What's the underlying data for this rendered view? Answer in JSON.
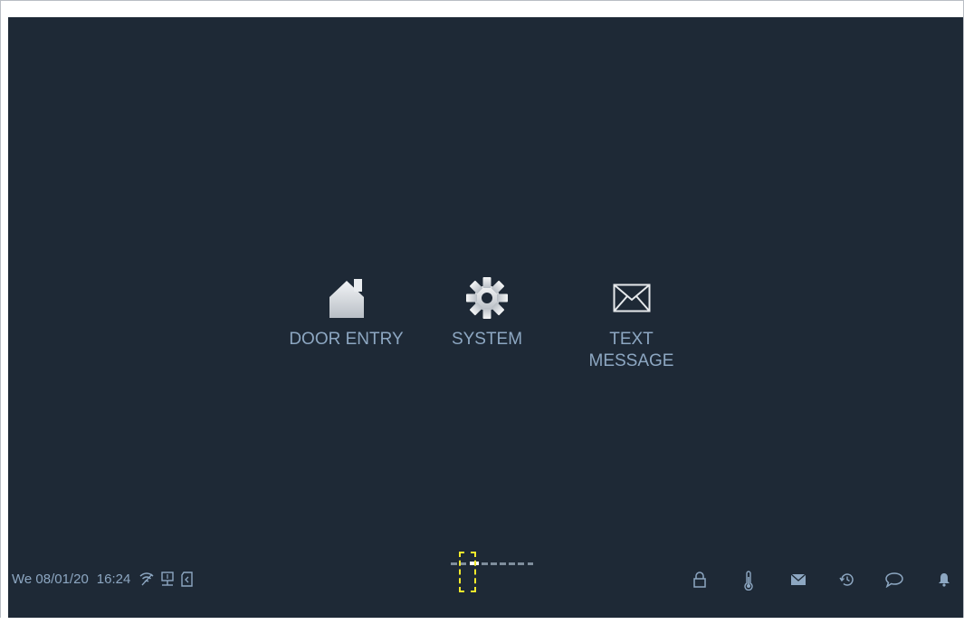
{
  "menu": {
    "items": [
      {
        "label": "DOOR ENTRY",
        "icon": "house-icon"
      },
      {
        "label": "SYSTEM",
        "icon": "gear-icon"
      },
      {
        "label": "TEXT\nMESSAGE",
        "icon": "envelope-icon"
      }
    ]
  },
  "status_bar": {
    "date": "We 08/01/20",
    "time": "16:24",
    "left_icons": [
      "wifi-icon",
      "network-icon",
      "sd-card-icon"
    ],
    "right_icons": [
      "lock-icon",
      "thermometer-icon",
      "mail-icon",
      "history-icon",
      "chat-icon",
      "bell-icon"
    ]
  },
  "pager": {
    "page_count": 8,
    "current_page": 2
  },
  "colors": {
    "screen_bg": "#1e2936",
    "label": "#8da7c2",
    "icon": "#d9dde1",
    "highlight": "#f2ea2c"
  }
}
